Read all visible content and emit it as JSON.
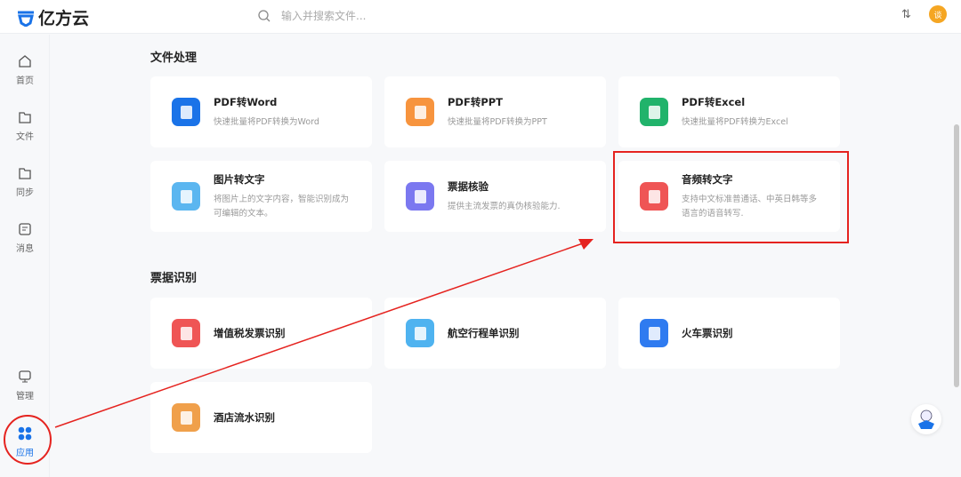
{
  "header": {
    "logo": "亿方云",
    "search_placeholder": "输入并搜索文件...",
    "avatar": "谈"
  },
  "sidebar": {
    "items": [
      {
        "label": "首页"
      },
      {
        "label": "文件"
      },
      {
        "label": "同步"
      },
      {
        "label": "消息"
      },
      {
        "label": "管理"
      },
      {
        "label": "应用"
      }
    ]
  },
  "sections": [
    {
      "title": "文件处理",
      "cards": [
        {
          "title": "PDF转Word",
          "desc": "快速批量将PDF转换为Word",
          "color": "#1a73e8"
        },
        {
          "title": "PDF转PPT",
          "desc": "快速批量将PDF转换为PPT",
          "color": "#f7943e"
        },
        {
          "title": "PDF转Excel",
          "desc": "快速批量将PDF转换为Excel",
          "color": "#21b36b"
        },
        {
          "title": "图片转文字",
          "desc": "将图片上的文字内容，智能识别成为可编辑的文本。",
          "color": "#5bb6f0"
        },
        {
          "title": "票据核验",
          "desc": "提供主流发票的真伪核验能力.",
          "color": "#7b78f0"
        },
        {
          "title": "音频转文字",
          "desc": "支持中文标准普通话、中英日韩等多语言的语音转写.",
          "color": "#ef5555"
        }
      ]
    },
    {
      "title": "票据识别",
      "cards": [
        {
          "title": "增值税发票识别",
          "desc": "",
          "color": "#ef5555"
        },
        {
          "title": "航空行程单识别",
          "desc": "",
          "color": "#4fb3f0"
        },
        {
          "title": "火车票识别",
          "desc": "",
          "color": "#2f7bf0"
        },
        {
          "title": "酒店流水识别",
          "desc": "",
          "color": "#f0a04b"
        }
      ]
    }
  ],
  "annotation_color": "#e5231f"
}
